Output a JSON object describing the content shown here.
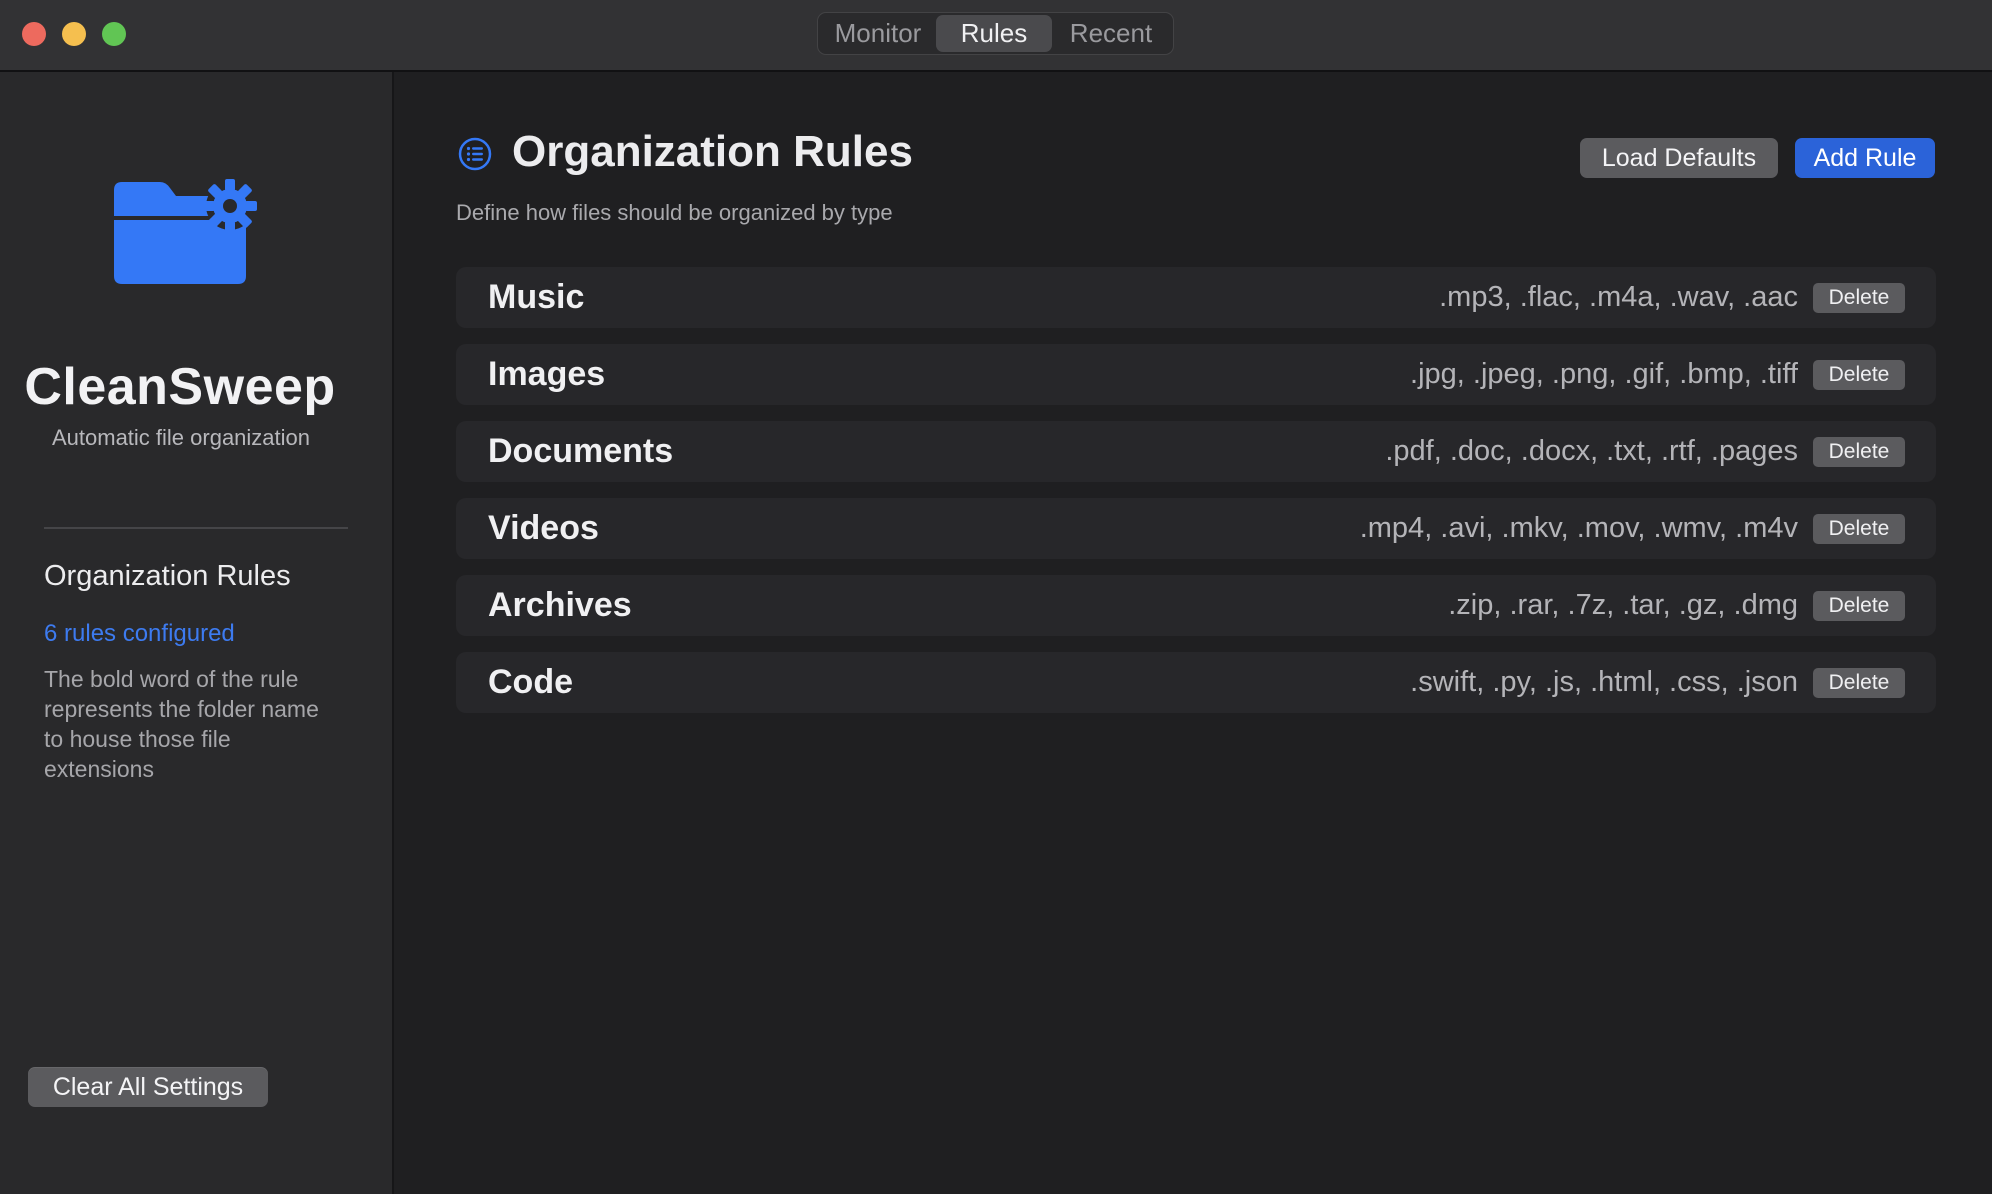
{
  "titlebar": {
    "tabs": [
      {
        "label": "Monitor",
        "active": false
      },
      {
        "label": "Rules",
        "active": true
      },
      {
        "label": "Recent",
        "active": false
      }
    ]
  },
  "sidebar": {
    "app_icon": "folder-gear-icon",
    "app_name": "CleanSweep",
    "tagline": "Automatic file organization",
    "section_title": "Organization Rules",
    "rules_count": "6 rules configured",
    "note": "The bold word of the rule represents the folder name to house those file extensions",
    "clear_button": "Clear All Settings"
  },
  "main": {
    "header_icon": "list-bullet-icon",
    "title": "Organization Rules",
    "subtitle": "Define how files should be organized by type",
    "load_defaults_button": "Load Defaults",
    "add_rule_button": "Add Rule",
    "delete_label": "Delete",
    "rules": [
      {
        "name": "Music",
        "extensions": ".mp3, .flac, .m4a, .wav, .aac"
      },
      {
        "name": "Images",
        "extensions": ".jpg, .jpeg, .png, .gif, .bmp, .tiff"
      },
      {
        "name": "Documents",
        "extensions": ".pdf, .doc, .docx, .txt, .rtf, .pages"
      },
      {
        "name": "Videos",
        "extensions": ".mp4, .avi, .mkv, .mov, .wmv, .m4v"
      },
      {
        "name": "Archives",
        "extensions": ".zip, .rar, .7z, .tar, .gz, .dmg"
      },
      {
        "name": "Code",
        "extensions": ".swift, .py, .js, .html, .css, .json"
      }
    ]
  },
  "colors": {
    "accent": "#2b63d9",
    "link": "#3d7bf0",
    "background": "#1f1f21",
    "sidebar": "#29292b"
  }
}
